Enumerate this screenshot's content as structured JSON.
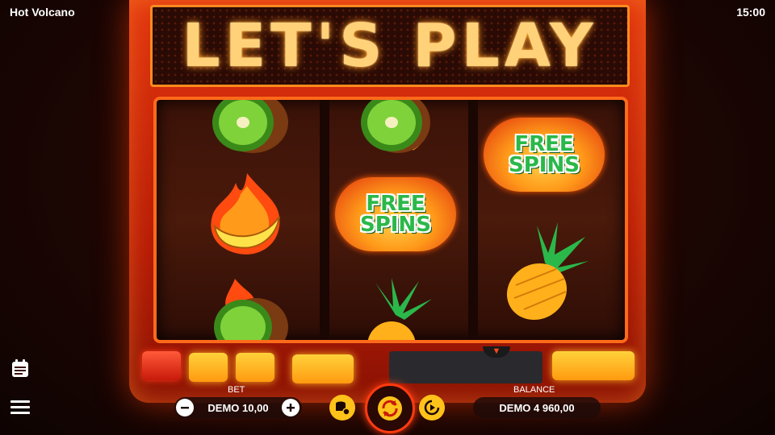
{
  "app": {
    "title": "Hot Volcano",
    "time": "15:00"
  },
  "marquee": {
    "text": "LET'S PLAY"
  },
  "reels": [
    {
      "symbols": [
        "kiwi",
        "banana",
        "kiwi"
      ]
    },
    {
      "symbols": [
        "kiwi",
        "free-spins",
        "pineapple"
      ]
    },
    {
      "symbols": [
        "free-spins",
        "pineapple"
      ]
    }
  ],
  "free_spins": {
    "line1": "FREE",
    "line2": "SPINS"
  },
  "controls": {
    "bet_label": "BET",
    "bet_value": "DEMO 10,00",
    "balance_label": "BALANCE",
    "balance_value": "DEMO 4 960,00"
  },
  "icons": {
    "history": "history-icon",
    "menu": "menu-icon",
    "minus": "minus-icon",
    "plus": "plus-icon",
    "coins": "coin-settings-icon",
    "spin": "spin-icon",
    "autoplay": "autoplay-icon"
  },
  "colors": {
    "accent": "#ff6a1a",
    "gold": "#ffc21a",
    "green": "#2bb84a",
    "cabinet": "#d42a0c"
  }
}
